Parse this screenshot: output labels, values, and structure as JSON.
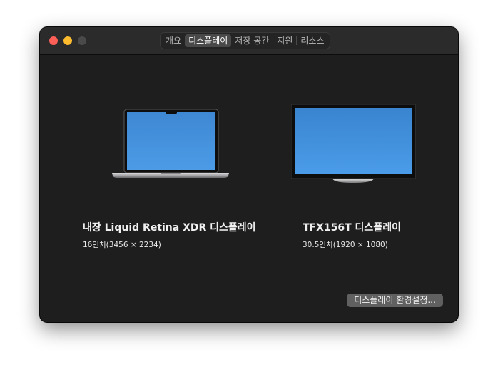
{
  "window": {
    "tabs": [
      {
        "label": "개요",
        "active": false
      },
      {
        "label": "디스플레이",
        "active": true
      },
      {
        "label": "저장 공간",
        "active": false
      },
      {
        "label": "지원",
        "active": false
      },
      {
        "label": "리소스",
        "active": false
      }
    ]
  },
  "displays": [
    {
      "name": "내장 Liquid Retina XDR 디스플레이",
      "spec": "16인치(3456 × 2234)",
      "icon": "laptop-icon"
    },
    {
      "name": "TFX156T 디스플레이",
      "spec": "30.5인치(1920 × 1080)",
      "icon": "monitor-icon"
    }
  ],
  "display_preferences_button": "디스플레이 환경설정...",
  "colors": {
    "window_bg": "#1f1e1f",
    "titlebar_bg": "#2c2b2c",
    "close": "#fe5f57",
    "minimize": "#febc2e",
    "zoom_disabled": "#4b4a4b",
    "screen_blue": "#3a8ad8"
  }
}
